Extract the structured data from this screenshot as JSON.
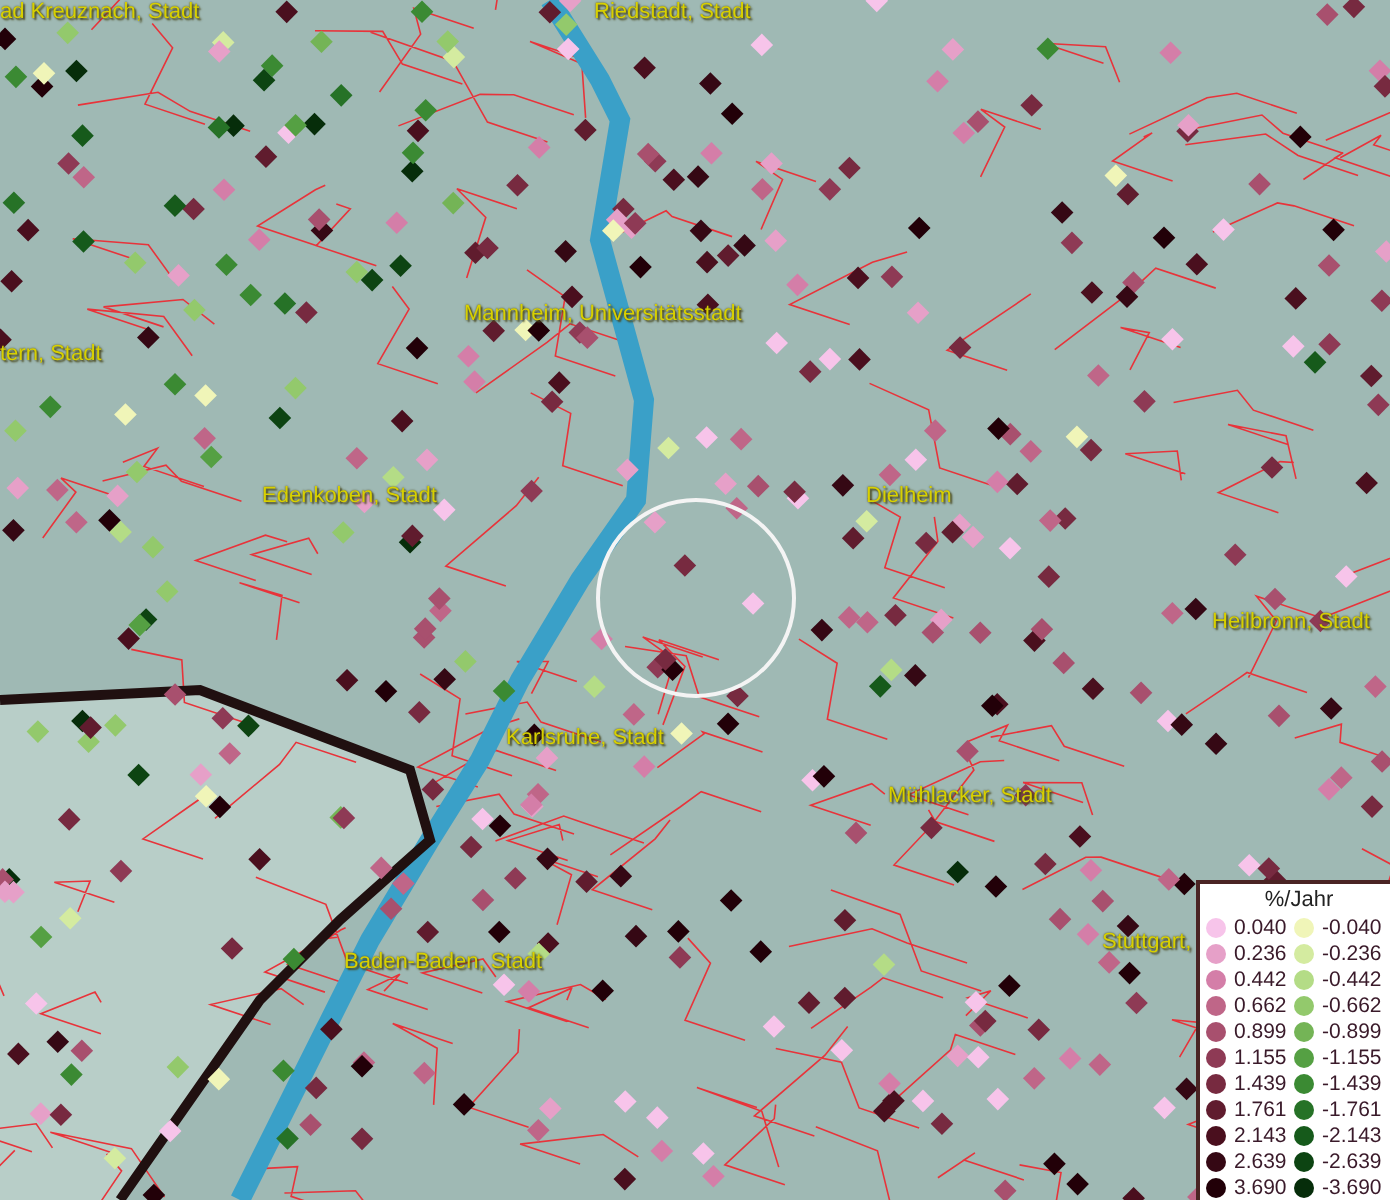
{
  "map": {
    "labels": [
      {
        "text": "ad Kreuznach, Stadt"
      },
      {
        "text": "Riedstadt, Stadt"
      },
      {
        "text": "Mannheim, Universitätsstadt"
      },
      {
        "text": "tern, Stadt"
      },
      {
        "text": "Edenkoben, Stadt"
      },
      {
        "text": "Dielheim"
      },
      {
        "text": "Heilbronn, Stadt"
      },
      {
        "text": "Karlsruhe, Stadt"
      },
      {
        "text": "Mühlacker, Stadt"
      },
      {
        "text": "Baden-Baden, Stadt"
      },
      {
        "text": "Stuttgart,"
      }
    ]
  },
  "legend": {
    "title": "%/Jahr",
    "rows": [
      {
        "positive": {
          "label": "0.040",
          "color": "#f7c4ea"
        },
        "negative": {
          "label": "-0.040",
          "color": "#f0f5b8"
        }
      },
      {
        "positive": {
          "label": "0.236",
          "color": "#e6a0c8"
        },
        "negative": {
          "label": "-0.236",
          "color": "#d4eba0"
        }
      },
      {
        "positive": {
          "label": "0.442",
          "color": "#d47ea8"
        },
        "negative": {
          "label": "-0.442",
          "color": "#b4dc86"
        }
      },
      {
        "positive": {
          "label": "0.662",
          "color": "#bf6688"
        },
        "negative": {
          "label": "-0.662",
          "color": "#93c96c"
        }
      },
      {
        "positive": {
          "label": "0.899",
          "color": "#a8506e"
        },
        "negative": {
          "label": "-0.899",
          "color": "#74b456"
        }
      },
      {
        "positive": {
          "label": "1.155",
          "color": "#8e3a55"
        },
        "negative": {
          "label": "-1.155",
          "color": "#55a043"
        }
      },
      {
        "positive": {
          "label": "1.439",
          "color": "#772a40"
        },
        "negative": {
          "label": "-1.439",
          "color": "#3b8a33"
        }
      },
      {
        "positive": {
          "label": "1.761",
          "color": "#601c2e"
        },
        "negative": {
          "label": "-1.761",
          "color": "#267227"
        }
      },
      {
        "positive": {
          "label": "2.143",
          "color": "#4a0f1e"
        },
        "negative": {
          "label": "-2.143",
          "color": "#165a1b"
        }
      },
      {
        "positive": {
          "label": "2.639",
          "color": "#350814"
        },
        "negative": {
          "label": "-2.639",
          "color": "#0d4412"
        }
      },
      {
        "positive": {
          "label": "3.690",
          "color": "#220008"
        },
        "negative": {
          "label": "-3.690",
          "color": "#062d0a"
        }
      }
    ]
  }
}
